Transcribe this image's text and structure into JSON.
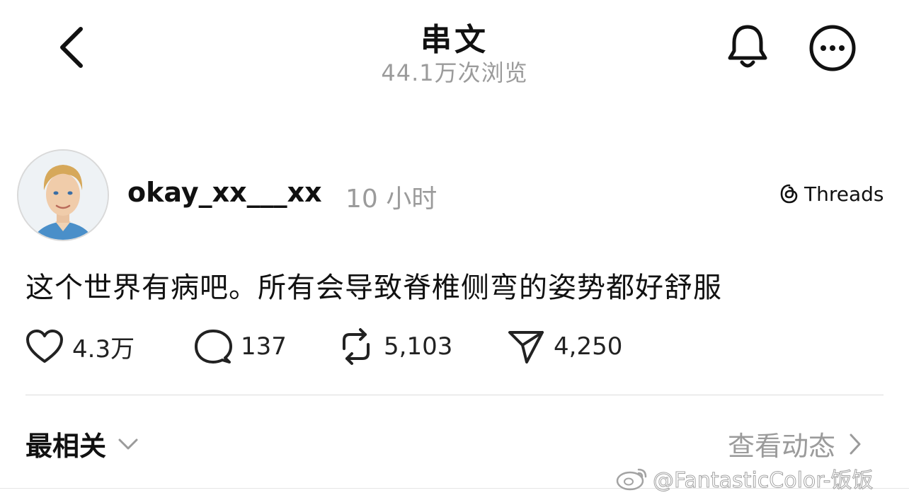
{
  "header": {
    "title": "串文",
    "views": "44.1万次浏览",
    "back_icon": "chevron-left-icon",
    "bell_icon": "bell-icon",
    "more_icon": "more-circle-icon"
  },
  "post": {
    "username": "okay_xx___xx",
    "time": "10 小时",
    "platform": "Threads",
    "text": "这个世界有病吧。所有会导致脊椎侧弯的姿势都好舒服",
    "stats": {
      "likes": "4.3万",
      "replies": "137",
      "reposts": "5,103",
      "shares": "4,250"
    }
  },
  "footer": {
    "sort_label": "最相关",
    "activity_label": "查看动态"
  },
  "watermark": {
    "text": "@FantasticColor-饭饭"
  },
  "colors": {
    "text": "#111111",
    "muted": "#9b9b9b",
    "divider": "#dcdcdc"
  }
}
